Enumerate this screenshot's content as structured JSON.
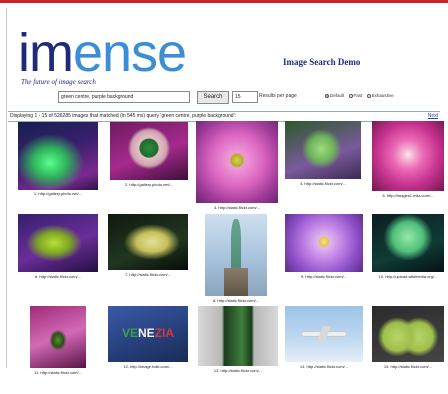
{
  "brand": {
    "logo_part1": "im",
    "logo_part2": "ense",
    "tagline": "The future of image search"
  },
  "header": {
    "title": "Image Search Demo"
  },
  "search": {
    "query": "green centre, purple background",
    "button_label": "Search",
    "results_per_page": "15",
    "results_per_page_label": "Results per page",
    "modes": [
      {
        "label": "Default",
        "selected": true
      },
      {
        "label": "Fast",
        "selected": false
      },
      {
        "label": "Exhaustive",
        "selected": false
      }
    ]
  },
  "results": {
    "summary": "Displaying 1 - 15 of 526285 images that matched (in 545 ms) query 'green centre, purple background':",
    "next_label": "Next",
    "items": [
      {
        "caption": "1. http://gallery.photo.net/..."
      },
      {
        "caption": "2. http://gallery.photo.net/..."
      },
      {
        "caption": "3. http://static.flickr.com/..."
      },
      {
        "caption": "4. http://static.flickr.com/..."
      },
      {
        "caption": "5. http://images1.mila.com/..."
      },
      {
        "caption": "6. http://static.flickr.com/..."
      },
      {
        "caption": "7. http://static.flickr.com/..."
      },
      {
        "caption": "8. http://static.flickr.com/..."
      },
      {
        "caption": "9. http://static.flickr.com/..."
      },
      {
        "caption": "10. http://upload.wikimedia.org/..."
      },
      {
        "caption": "11. http://static.flickr.com/..."
      },
      {
        "caption": "12. http://image.fotki.com/..."
      },
      {
        "caption": "13. http://static.flickr.com/..."
      },
      {
        "caption": "14. http://static.flickr.com/..."
      },
      {
        "caption": "15. http://static.flickr.com/..."
      }
    ]
  },
  "colors": {
    "top_bar": "#c9262a",
    "brand_dark": "#1f2b78",
    "brand_light": "#3b8ed6",
    "link": "#2a47b8"
  }
}
